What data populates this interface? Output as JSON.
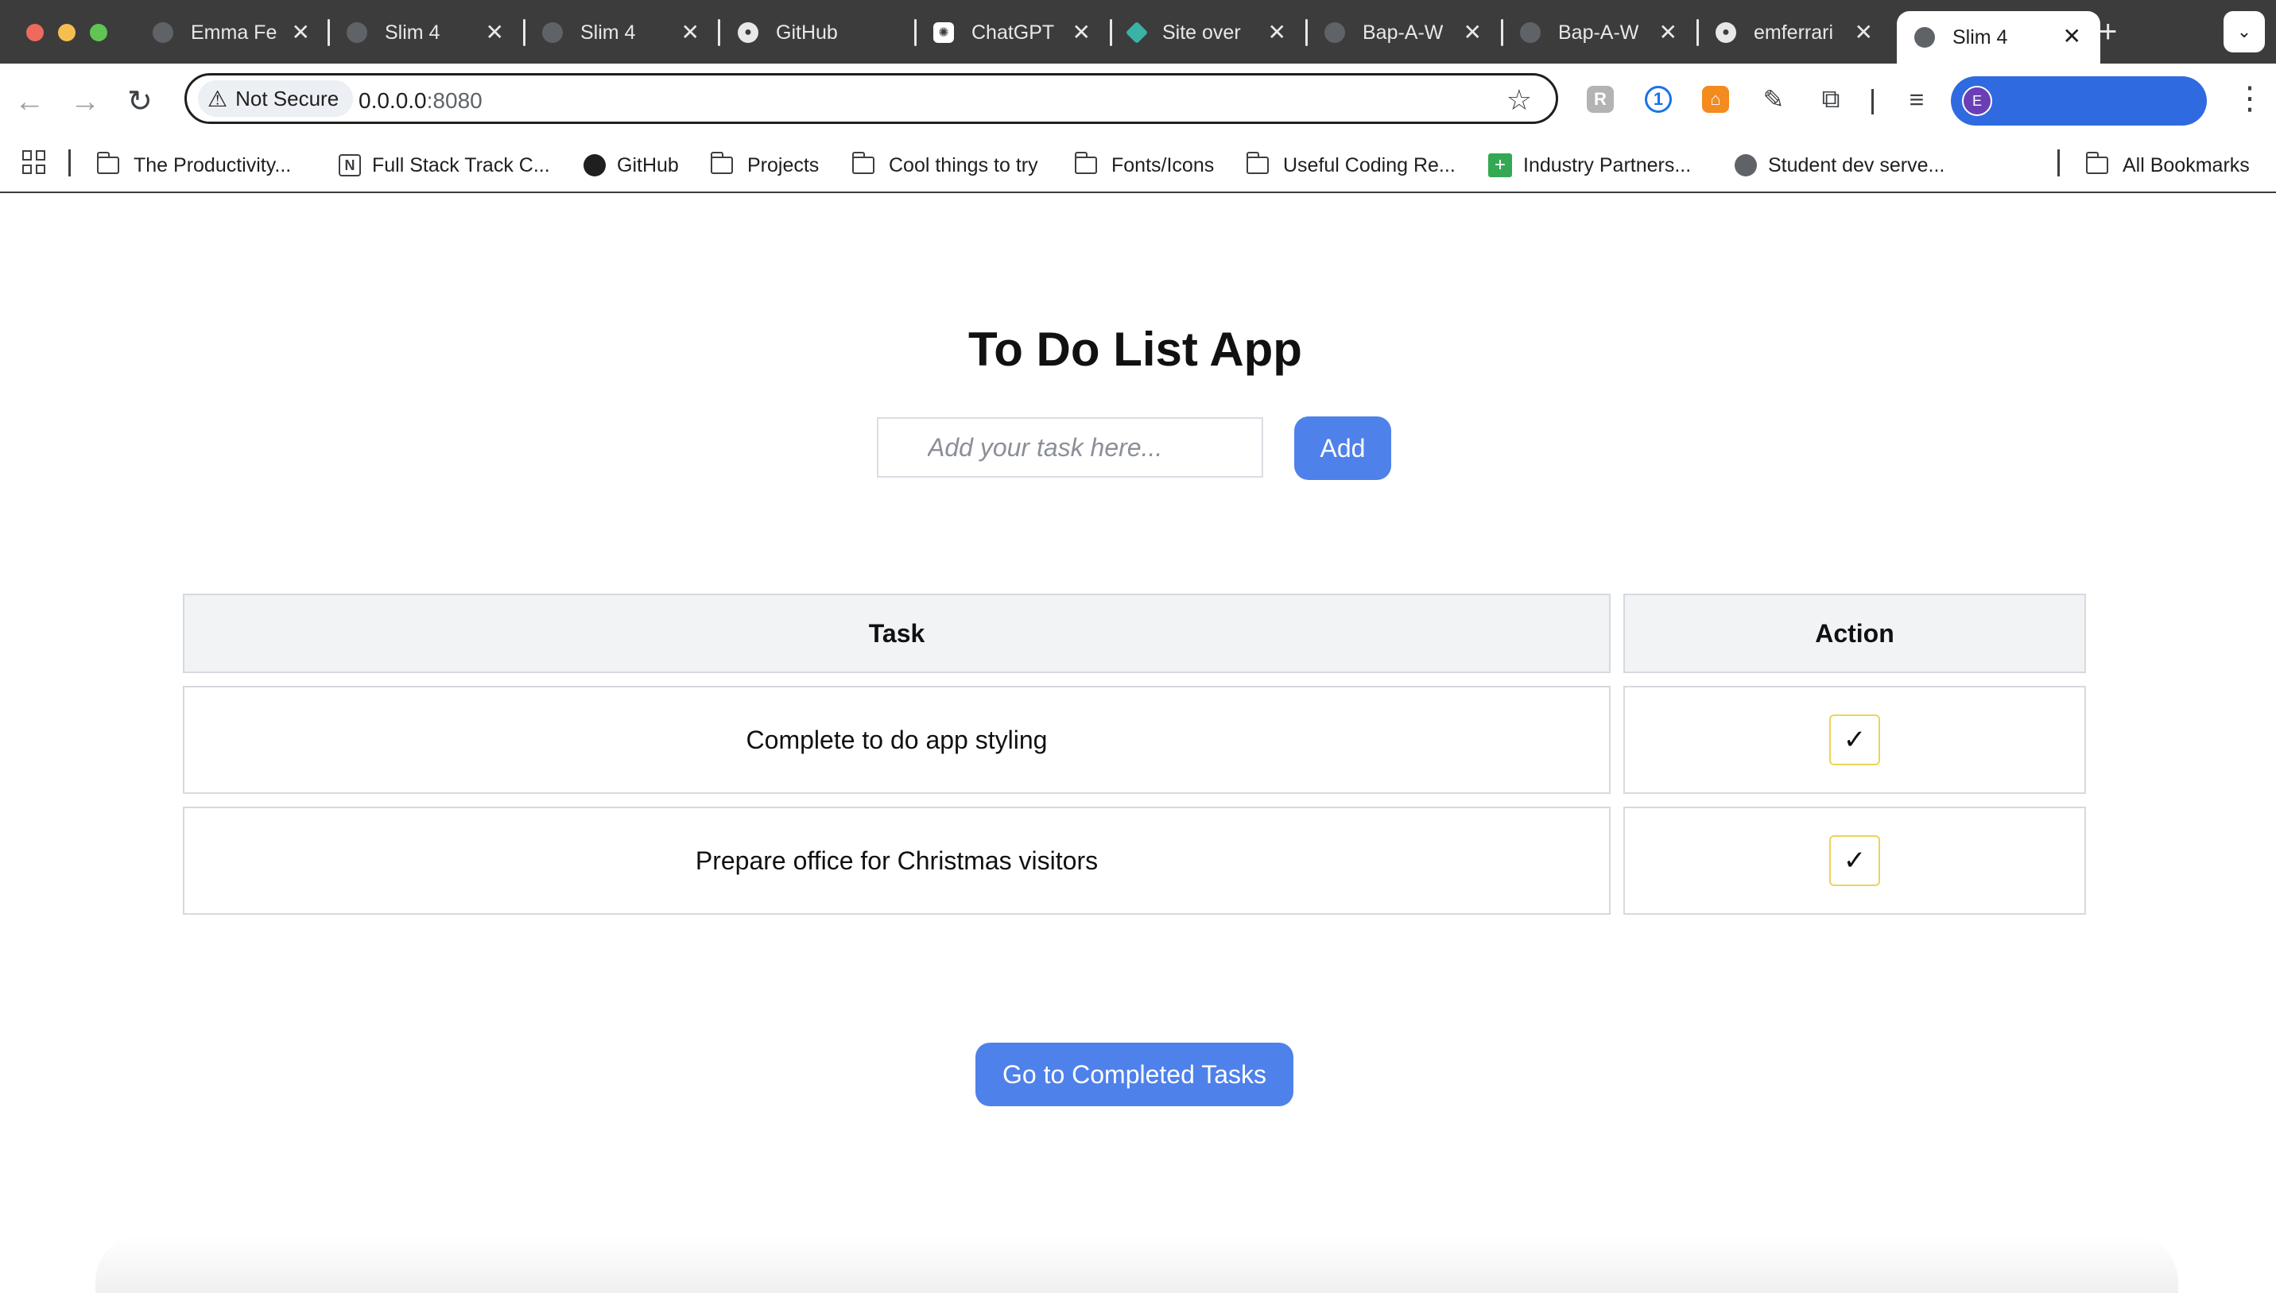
{
  "browser": {
    "tabs": [
      {
        "title": "Emma Fe",
        "icon": "globe-icon"
      },
      {
        "title": "Slim 4",
        "icon": "globe-icon"
      },
      {
        "title": "Slim 4",
        "icon": "globe-icon"
      },
      {
        "title": "GitHub",
        "icon": "github-icon"
      },
      {
        "title": "ChatGPT",
        "icon": "chatgpt-icon"
      },
      {
        "title": "Site over",
        "icon": "diamond-icon"
      },
      {
        "title": "Bap-A-W",
        "icon": "globe-icon"
      },
      {
        "title": "Bap-A-W",
        "icon": "globe-icon"
      },
      {
        "title": "emferrari",
        "icon": "github-icon"
      },
      {
        "title": "Slim 4",
        "icon": "globe-icon",
        "active": true
      }
    ],
    "security_label": "Not Secure",
    "url_host": "0.0.0.0",
    "url_port": ":8080",
    "profile_initial": "E",
    "bookmarks": [
      {
        "label": "The Productivity...",
        "icon": "folder-icon"
      },
      {
        "label": "Full Stack Track C...",
        "icon": "notion-icon"
      },
      {
        "label": "GitHub",
        "icon": "github-icon"
      },
      {
        "label": "Projects",
        "icon": "folder-icon"
      },
      {
        "label": "Cool things to try",
        "icon": "folder-icon"
      },
      {
        "label": "Fonts/Icons",
        "icon": "folder-icon"
      },
      {
        "label": "Useful Coding Re...",
        "icon": "folder-icon"
      },
      {
        "label": "Industry Partners...",
        "icon": "sheets-icon"
      },
      {
        "label": "Student dev serve...",
        "icon": "globe-icon"
      }
    ],
    "all_bookmarks": "All Bookmarks"
  },
  "app": {
    "title": "To Do List App",
    "input_placeholder": "Add your task here...",
    "add_label": "Add",
    "table": {
      "headers": [
        "Task",
        "Action"
      ],
      "rows": [
        {
          "task": "Complete to do app styling",
          "action": "✓"
        },
        {
          "task": "Prepare office for Christmas visitors",
          "action": "✓"
        }
      ]
    },
    "completed_label": "Go to Completed Tasks"
  },
  "colors": {
    "accent": "#4f81ea",
    "tab_strip": "#3c3c3c",
    "checkbox_border": "#ecd35b",
    "header_cell": "#f2f3f5"
  }
}
